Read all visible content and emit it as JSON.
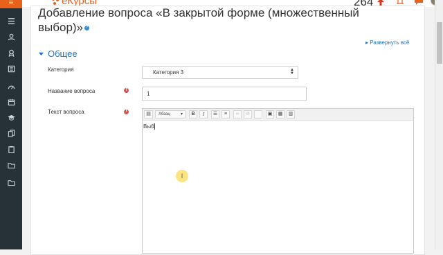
{
  "app": {
    "logo_text": "еКурсы",
    "notification_count": "264",
    "brand_color": "#e8621c",
    "link_color": "#1a73c9",
    "sidebar_color": "#263238"
  },
  "sidebar": {
    "items": [
      {
        "icon": "menu-icon"
      },
      {
        "icon": "list-icon"
      },
      {
        "icon": "user-icon"
      },
      {
        "icon": "badge-icon"
      },
      {
        "icon": "book-icon"
      },
      {
        "icon": "dashboard-icon"
      },
      {
        "icon": "calendar-icon"
      },
      {
        "icon": "graduation-icon"
      },
      {
        "icon": "copy-icon"
      },
      {
        "icon": "clipboard-icon"
      },
      {
        "icon": "folder-icon"
      },
      {
        "icon": "folder-icon"
      }
    ]
  },
  "page": {
    "title": "Добавление вопроса «В закрытой форме (множественный выбор)»",
    "expand_all": "Развернуть всё",
    "section_title": "Общее"
  },
  "form": {
    "category_label": "Категория",
    "category_value": "Категория 3",
    "name_label": "Название вопроса",
    "name_value": "1",
    "text_label": "Текст вопроса",
    "text_value": "Выб"
  },
  "editor": {
    "style_select": "Абзац",
    "bold": "B",
    "italic": "I"
  }
}
